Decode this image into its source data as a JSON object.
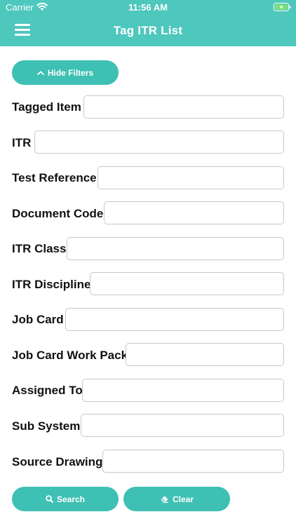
{
  "status_bar": {
    "carrier": "Carrier",
    "time": "11:56 AM",
    "icons": [
      "wifi-icon",
      "battery-charging-icon"
    ]
  },
  "nav": {
    "title": "Tag ITR List",
    "menu_icon": "hamburger-menu-icon"
  },
  "filters_toggle": {
    "label": "Hide Filters",
    "icon": "chevron-up-icon"
  },
  "fields": [
    {
      "label": "Tagged Item",
      "value": ""
    },
    {
      "label": "ITR",
      "value": ""
    },
    {
      "label": "Test Reference",
      "value": ""
    },
    {
      "label": "Document Code",
      "value": ""
    },
    {
      "label": "ITR Class",
      "value": ""
    },
    {
      "label": "ITR Discipline",
      "value": ""
    },
    {
      "label": "Job Card",
      "value": ""
    },
    {
      "label": "Job Card Work Pack",
      "value": ""
    },
    {
      "label": "Assigned To",
      "value": ""
    },
    {
      "label": "Sub System",
      "value": ""
    },
    {
      "label": "Source Drawing",
      "value": ""
    }
  ],
  "actions": {
    "search_label": "Search",
    "search_icon": "search-icon",
    "clear_label": "Clear",
    "clear_icon": "eraser-icon"
  },
  "colors": {
    "accent": "#3fc0b4",
    "header": "#4ec7bd",
    "text": "#111111",
    "input_border": "#c8c8c8"
  }
}
